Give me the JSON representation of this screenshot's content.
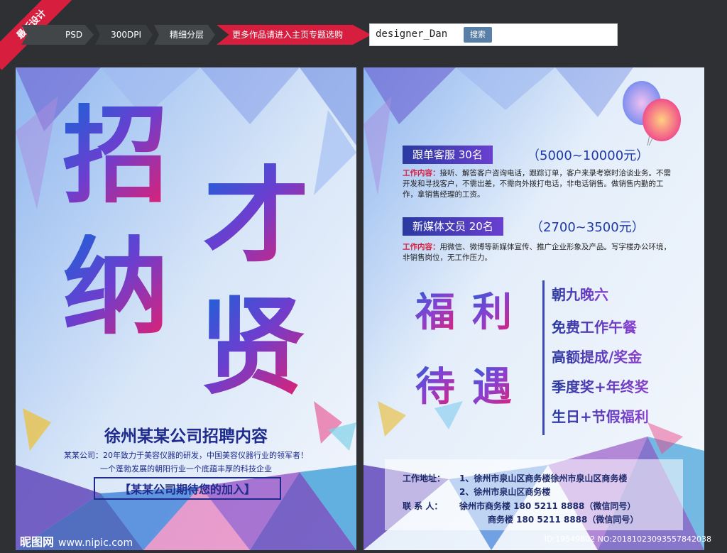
{
  "ribbon": "最新设计",
  "tabs": [
    "PSD",
    "300DPI",
    "精细分层",
    "更多作品请进入主页专题选购"
  ],
  "search": {
    "value": "designer_Dan",
    "button": "搜索"
  },
  "left": {
    "big_chars": [
      "招",
      "纳",
      "才",
      "贤"
    ],
    "headline": "徐州某某公司招聘内容",
    "sub1": "某某公司：20年致力于美容仪器的研发，中国美容仪器行业的领军者！",
    "sub2": "一个蓬勃发展的朝阳行业一个底蕴丰厚的科技企业",
    "slogan": "【某某公司期待您的加入】"
  },
  "jobs": [
    {
      "title": "跟单客服  30名",
      "salary": "（5000~10000元）",
      "label": "工作内容：",
      "desc": "接听、解答客户咨询电话，跟踪订单，客户来录考察时洽谈业务。不需开发和寻找客户，不需出差，不需向外拨打电话，非电话销售。做销售内勤的工作，拿销售经理的工资。"
    },
    {
      "title": "新媒体文员  20名",
      "salary": "（2700~3500元）",
      "label": "工作内容：",
      "desc": "用微信、微博等新媒体宣传、推广企业形象及产品。写字楼办公环境，非销售岗位，无工作压力。"
    }
  ],
  "welfare": {
    "chars": [
      "福",
      "利",
      "待",
      "遇"
    ],
    "items": [
      "朝九晚六",
      "免费工作午餐",
      "高额提成/奖金",
      "季度奖+年终奖",
      "生日+节假福利"
    ]
  },
  "contact": {
    "addr_label": "工作地址：",
    "addr1": "1、徐州市泉山区商务楼徐州市泉山区商务楼",
    "addr2": "2、徐州市泉山区商务楼",
    "person_label": "联 系 人：",
    "line1": "徐州市商务楼  180 5211 8888（微信同号）",
    "line2": "商务楼  180 5211 8888（微信同号）"
  },
  "footer": {
    "logo": "昵图网",
    "url": "www.nipic.com",
    "id": "ID:19549802 NO:20181023093557842038"
  },
  "colors": {
    "accent": "#d81e3f",
    "navy": "#1e2a8c",
    "blue": "#1a63d8",
    "pink": "#e81e6c"
  }
}
